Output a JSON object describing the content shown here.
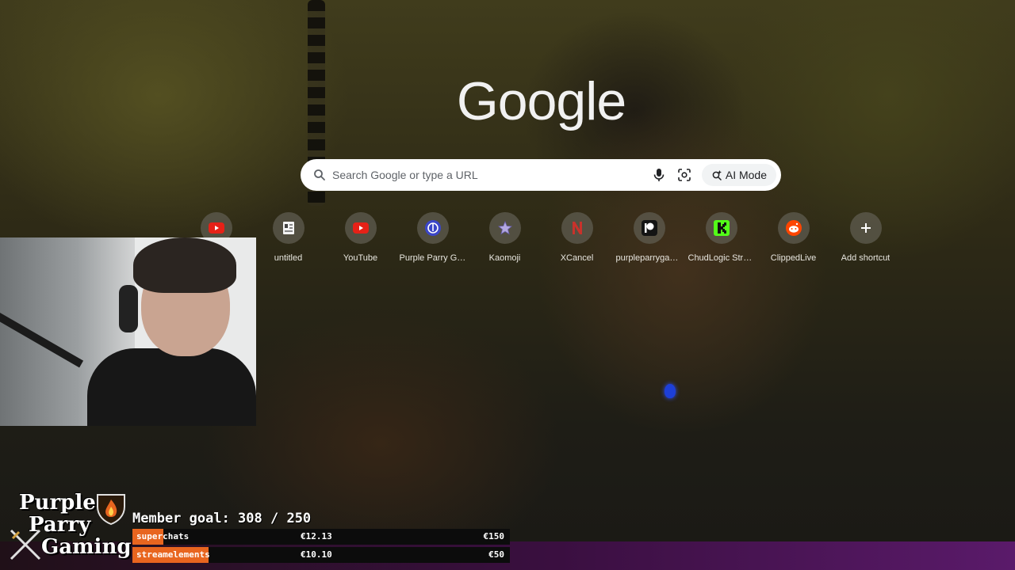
{
  "google": {
    "logo_text": "Google",
    "search_placeholder": "Search Google or type a URL",
    "ai_mode_label": "AI Mode"
  },
  "shortcuts": [
    {
      "title": "",
      "icon": "youtube-icon",
      "color": "#e62117"
    },
    {
      "title": "untitled",
      "icon": "document-icon",
      "color": "#ffffff"
    },
    {
      "title": "YouTube",
      "icon": "youtube-icon",
      "color": "#e62117"
    },
    {
      "title": "Purple Parry Ga...",
      "icon": "anchor-icon",
      "color": "#3b46c8"
    },
    {
      "title": "Kaomoji",
      "icon": "star-icon",
      "color": "#b3a8e0"
    },
    {
      "title": "XCancel",
      "icon": "n-letter-icon",
      "color": "#c8322b"
    },
    {
      "title": "purpleparrygam...",
      "icon": "patreon-icon",
      "color": "#141414"
    },
    {
      "title": "ChudLogic Stre...",
      "icon": "kick-icon",
      "color": "#53fc18"
    },
    {
      "title": "ClippedLive",
      "icon": "reddit-icon",
      "color": "#ff4500"
    },
    {
      "title": "Add shortcut",
      "icon": "plus-icon",
      "color": "#ffffff"
    }
  ],
  "overlay": {
    "brand_line1": "Purple",
    "brand_line2": "Parry",
    "brand_line3": "Gaming",
    "member_goal": "Member goal: 308 / 250",
    "goals": [
      {
        "name": "superchats",
        "current": "€12.13",
        "target": "€150",
        "progress": 0.081,
        "color": "#e8651f"
      },
      {
        "name": "streamelements",
        "current": "€10.10",
        "target": "€50",
        "progress": 0.202,
        "color": "#e8651f"
      }
    ]
  }
}
